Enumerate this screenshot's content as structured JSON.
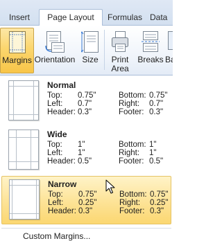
{
  "tabs": [
    {
      "label": "Insert",
      "active": false
    },
    {
      "label": "Page Layout",
      "active": true
    },
    {
      "label": "Formulas",
      "active": false
    },
    {
      "label": "Data",
      "active": false
    }
  ],
  "ribbon": {
    "buttons": [
      {
        "label": "Margins",
        "icon": "margins-icon",
        "selected": true
      },
      {
        "label": "Orientation",
        "icon": "orientation-icon"
      },
      {
        "label": "Size",
        "icon": "size-icon"
      },
      {
        "label": "Print\nArea",
        "icon": "print-area-icon"
      },
      {
        "label": "Breaks",
        "icon": "breaks-icon"
      },
      {
        "label": "Ba",
        "icon": "background-icon"
      }
    ]
  },
  "margins_menu": {
    "options": [
      {
        "name": "Normal",
        "top": "0.75\"",
        "bottom": "0.75\"",
        "left": "0.7\"",
        "right": "0.7\"",
        "header": "0.3\"",
        "footer": "0.3\"",
        "highlighted": false
      },
      {
        "name": "Wide",
        "top": "1\"",
        "bottom": "1\"",
        "left": "1\"",
        "right": "1\"",
        "header": "0.5\"",
        "footer": "0.5\"",
        "highlighted": false
      },
      {
        "name": "Narrow",
        "top": "0.75\"",
        "bottom": "0.75\"",
        "left": "0.25\"",
        "right": "0.25\"",
        "header": "0.3\"",
        "footer": "0.3\"",
        "highlighted": true
      }
    ],
    "field_labels": {
      "top": "Top:",
      "bottom": "Bottom:",
      "left": "Left:",
      "right": "Right:",
      "header": "Header:",
      "footer": "Footer:"
    },
    "custom_label": "Custom Margins..."
  },
  "colors": {
    "highlight": "#fbd771",
    "tab_border": "#a9bdd8"
  }
}
